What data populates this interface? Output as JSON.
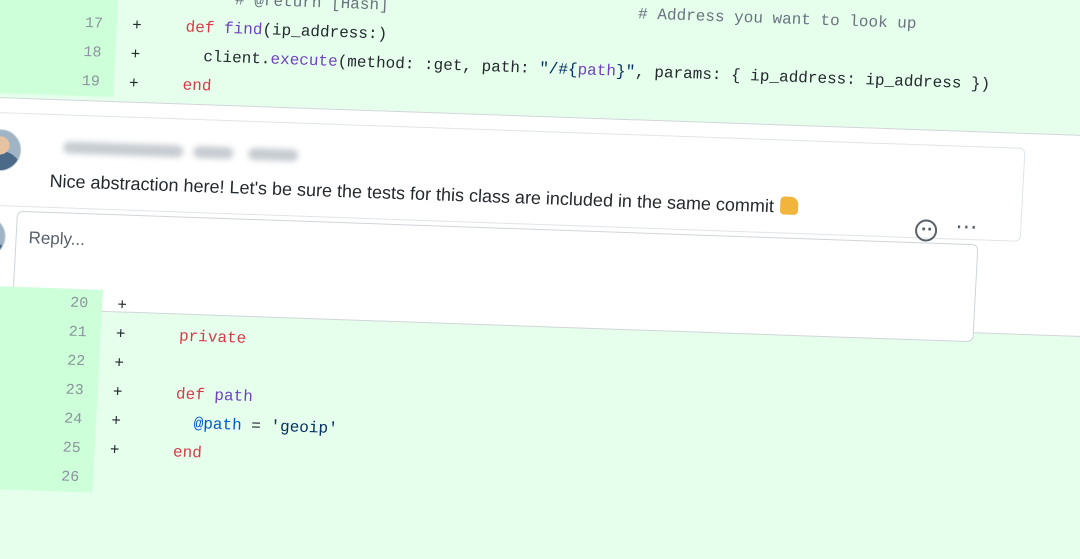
{
  "diff_top": [
    {
      "num": "",
      "sign": "",
      "parts": [
        [
          "comment",
          "        # @return [Hash]                          "
        ],
        [
          "comment",
          "# Address you want to look up"
        ]
      ]
    },
    {
      "num": "17",
      "sign": "+",
      "parts": [
        [
          "code",
          "   "
        ],
        [
          "kw",
          "def "
        ],
        [
          "fn",
          "find"
        ],
        [
          "code",
          "(ip_address:)"
        ]
      ]
    },
    {
      "num": "18",
      "sign": "+",
      "parts": [
        [
          "code",
          "     client."
        ],
        [
          "fn",
          "execute"
        ],
        [
          "code",
          "(method: :get, path: "
        ],
        [
          "str",
          "\"/#{"
        ],
        [
          "fn",
          "path"
        ],
        [
          "str",
          "}\""
        ],
        [
          "code",
          ", params: { ip_address: ip_address })"
        ]
      ]
    },
    {
      "num": "19",
      "sign": "+",
      "parts": [
        [
          "code",
          "   "
        ],
        [
          "kw",
          "end"
        ]
      ]
    }
  ],
  "comment": {
    "body": "Nice abstraction here! Let's be sure the tests for this class are included in the same commit",
    "reaction_icon": "smiley-icon",
    "more_icon": "kebab-horizontal-icon"
  },
  "reply": {
    "placeholder": "Reply..."
  },
  "diff_bottom": [
    {
      "num": "20",
      "sign": "+",
      "parts": []
    },
    {
      "num": "21",
      "sign": "+",
      "parts": [
        [
          "code",
          "    "
        ],
        [
          "kw",
          "private"
        ]
      ]
    },
    {
      "num": "22",
      "sign": "+",
      "parts": []
    },
    {
      "num": "23",
      "sign": "+",
      "parts": [
        [
          "code",
          "    "
        ],
        [
          "kw",
          "def "
        ],
        [
          "fn",
          "path"
        ]
      ]
    },
    {
      "num": "24",
      "sign": "+",
      "parts": [
        [
          "code",
          "      "
        ],
        [
          "ivar",
          "@path"
        ],
        [
          "code",
          " = "
        ],
        [
          "str",
          "'geoip'"
        ]
      ]
    },
    {
      "num": "25",
      "sign": "+",
      "parts": [
        [
          "code",
          "    "
        ],
        [
          "kw",
          "end"
        ]
      ]
    },
    {
      "num": "26",
      "sign": "",
      "parts": []
    }
  ],
  "colors": {
    "diff_added_bg": "#e6ffed",
    "diff_gutter_bg": "#cdffd8",
    "keyword": "#d73a49",
    "function": "#6f42c1",
    "string": "#032f62"
  }
}
